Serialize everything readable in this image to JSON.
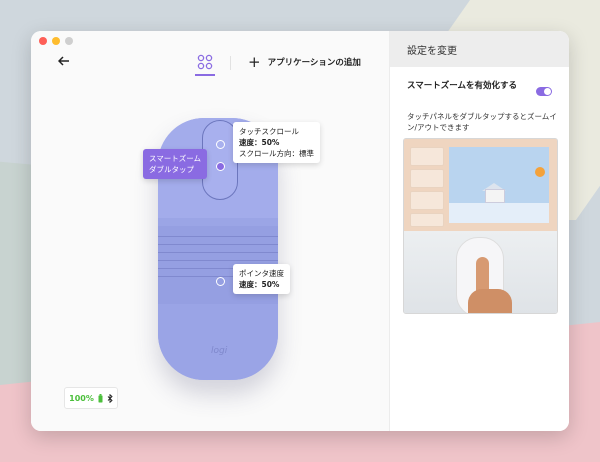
{
  "window": {
    "back_icon": "arrow-left-icon",
    "devices_icon": "devices-grid-icon",
    "add_app_label": "アプリケーションの追加"
  },
  "callouts": {
    "touch_scroll": {
      "title": "タッチスクロール",
      "line1": "速度：50%",
      "line2": "スクロール方向：標準"
    },
    "smart_zoom": {
      "line1": "スマートズーム",
      "line2": "ダブルタップ"
    },
    "pointer_speed": {
      "title": "ポインタ速度",
      "line1": "速度：50%"
    }
  },
  "device": {
    "brand": "logi",
    "battery_percent": "100%"
  },
  "side_panel": {
    "title": "設定を変更",
    "option_label": "スマートズームを有効化する",
    "toggle_on": true,
    "description": "タッチパネルをダブルタップするとズームイン/アウトできます"
  },
  "colors": {
    "accent": "#8a6be2",
    "device": "#9ba5e6",
    "battery": "#4bbf3b"
  }
}
